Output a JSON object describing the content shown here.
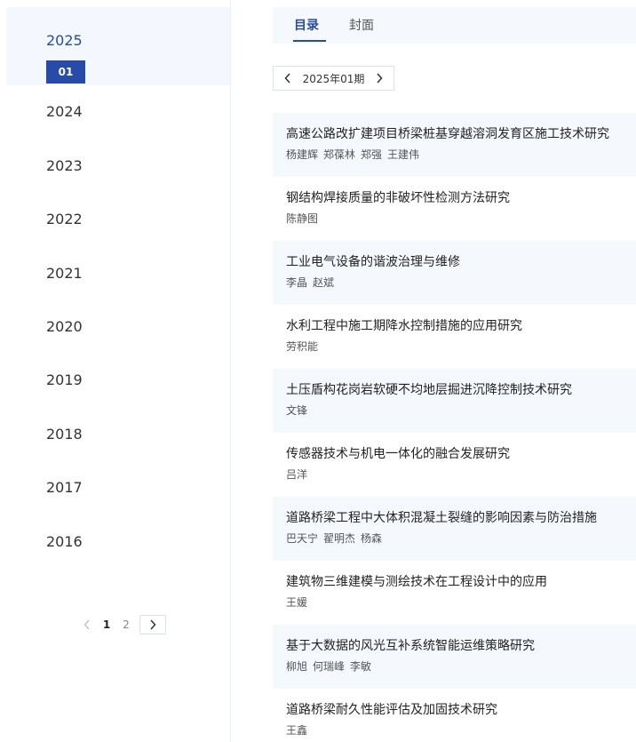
{
  "sidebar": {
    "active_year": "2025",
    "active_month": "01",
    "years": [
      "2024",
      "2023",
      "2022",
      "2021",
      "2020",
      "2019",
      "2018",
      "2017",
      "2016"
    ],
    "pager": {
      "pages": [
        "1",
        "2"
      ],
      "current": "1"
    }
  },
  "tabs": [
    {
      "label": "目录",
      "active": true
    },
    {
      "label": "封面",
      "active": false
    }
  ],
  "issue_selector": {
    "label": "2025年01期"
  },
  "articles": [
    {
      "title": "高速公路改扩建项目桥梁桩基穿越溶洞发育区施工技术研究",
      "authors": [
        "杨建辉",
        "郑葆林",
        "郑强",
        "王建伟"
      ]
    },
    {
      "title": "钢结构焊接质量的非破坏性检测方法研究",
      "authors": [
        "陈静图"
      ]
    },
    {
      "title": "工业电气设备的谐波治理与维修",
      "authors": [
        "李晶",
        "赵斌"
      ]
    },
    {
      "title": "水利工程中施工期降水控制措施的应用研究",
      "authors": [
        "劳积能"
      ]
    },
    {
      "title": "土压盾构花岗岩软硬不均地层掘进沉降控制技术研究",
      "authors": [
        "文锋"
      ]
    },
    {
      "title": "传感器技术与机电一体化的融合发展研究",
      "authors": [
        "吕洋"
      ]
    },
    {
      "title": "道路桥梁工程中大体积混凝土裂缝的影响因素与防治措施",
      "authors": [
        "巴天宁",
        "翟明杰",
        "杨森"
      ]
    },
    {
      "title": "建筑物三维建模与测绘技术在工程设计中的应用",
      "authors": [
        "王媛"
      ]
    },
    {
      "title": "基于大数据的风光互补系统智能运维策略研究",
      "authors": [
        "柳旭",
        "何瑞峰",
        "李敏"
      ]
    },
    {
      "title": "道路桥梁耐久性能评估及加固技术研究",
      "authors": [
        "王鑫"
      ]
    }
  ]
}
